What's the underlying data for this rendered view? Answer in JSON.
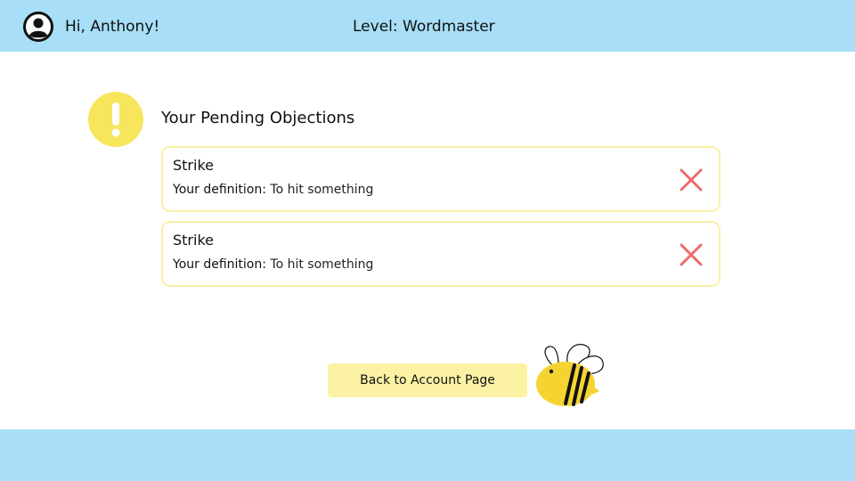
{
  "header": {
    "greeting": "Hi, Anthony!",
    "level": "Level: Wordmaster",
    "avatar_icon": "user-circle-icon"
  },
  "objections": {
    "icon": "exclamation-icon",
    "title": "Your Pending Objections",
    "items": [
      {
        "word": "Strike",
        "definition_label": "Your definition:",
        "definition": "To hit something",
        "remove_icon": "close-x-icon"
      },
      {
        "word": "Strike",
        "definition_label": "Your definition:",
        "definition": "To hit something",
        "remove_icon": "close-x-icon"
      }
    ]
  },
  "actions": {
    "back_label": "Back to Account Page"
  },
  "mascot": {
    "icon": "bee-icon"
  },
  "colors": {
    "bar": "#a8def7",
    "accent_yellow": "#faf0a6",
    "button_yellow": "#fcf2a4",
    "alert_yellow": "#f7e55c",
    "remove_red": "#ee6b6b",
    "bee_yellow": "#f5d432"
  }
}
